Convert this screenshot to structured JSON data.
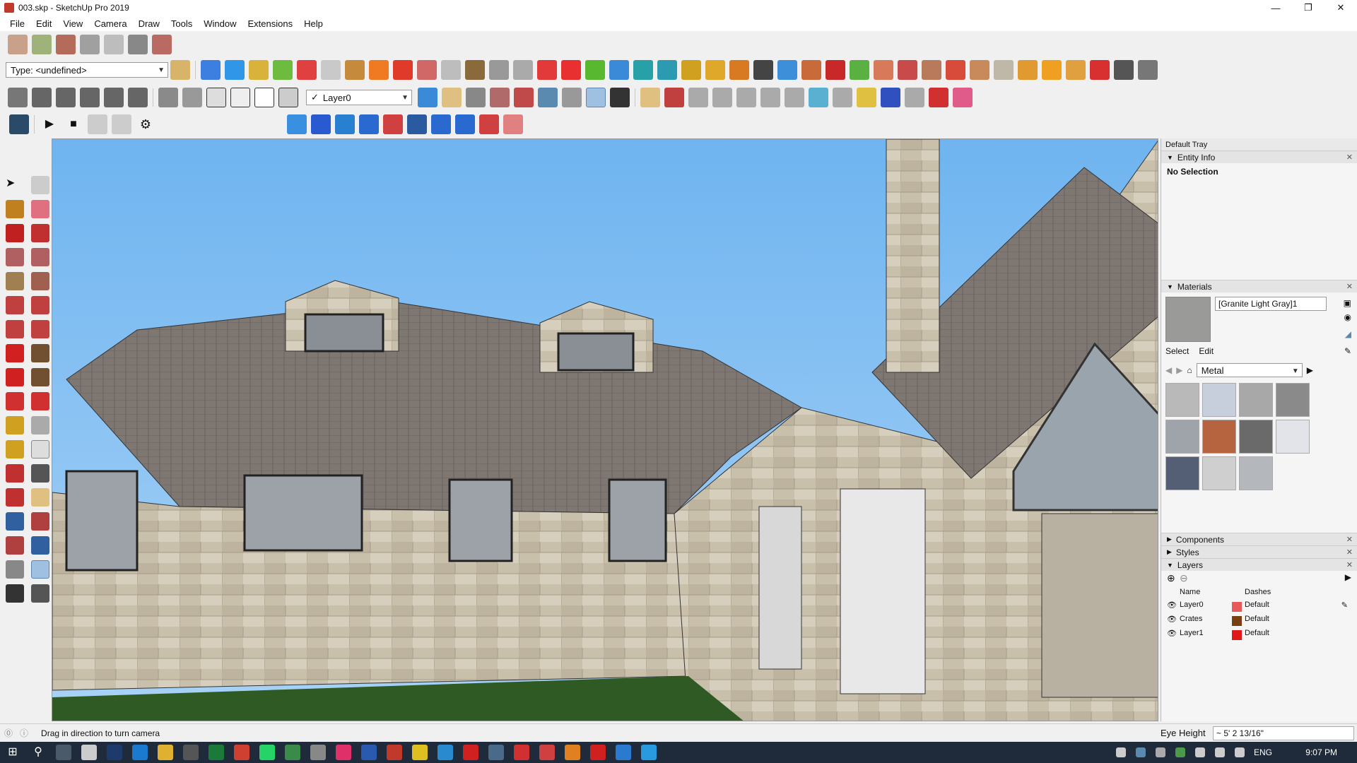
{
  "window": {
    "title": "003.skp - SketchUp Pro 2019",
    "controls": [
      "—",
      "❐",
      "✕"
    ]
  },
  "menu": [
    "File",
    "Edit",
    "View",
    "Camera",
    "Draw",
    "Tools",
    "Window",
    "Extensions",
    "Help"
  ],
  "toolbar": {
    "type_value": "Type: <undefined>",
    "layer_value": "Layer0",
    "layer_check": "✓"
  },
  "tray": {
    "title": "Default Tray",
    "entity_info": {
      "label": "Entity Info",
      "selection": "No Selection"
    },
    "materials": {
      "label": "Materials",
      "current_name": "[Granite Light Gray]1",
      "tabs": [
        "Select",
        "Edit"
      ],
      "library": "Metal",
      "swatch_colors": [
        "#b9b9b9",
        "#c7cfdc",
        "#a8a8a8",
        "#8a8a8a",
        "#9ea4aa",
        "#b5643f",
        "#6a6a6a",
        "#e2e4ea",
        "#545e75",
        "#cfcfcf",
        "#b4b8bc"
      ]
    },
    "components_label": "Components",
    "styles_label": "Styles",
    "layers": {
      "label": "Layers",
      "headers": [
        "Name",
        "Dashes"
      ],
      "rows": [
        {
          "name": "Layer0",
          "color": "#e85a5a",
          "dashes": "Default"
        },
        {
          "name": "Crates",
          "color": "#7a3f10",
          "dashes": "Default"
        },
        {
          "name": "Layer1",
          "color": "#e01818",
          "dashes": "Default"
        }
      ]
    }
  },
  "status": {
    "message": "Drag in direction to turn camera",
    "measure_label": "Eye Height",
    "measure_value": "~ 5' 2 13/16\""
  },
  "taskbar": {
    "language": "ENG",
    "time": "9:07 PM"
  }
}
